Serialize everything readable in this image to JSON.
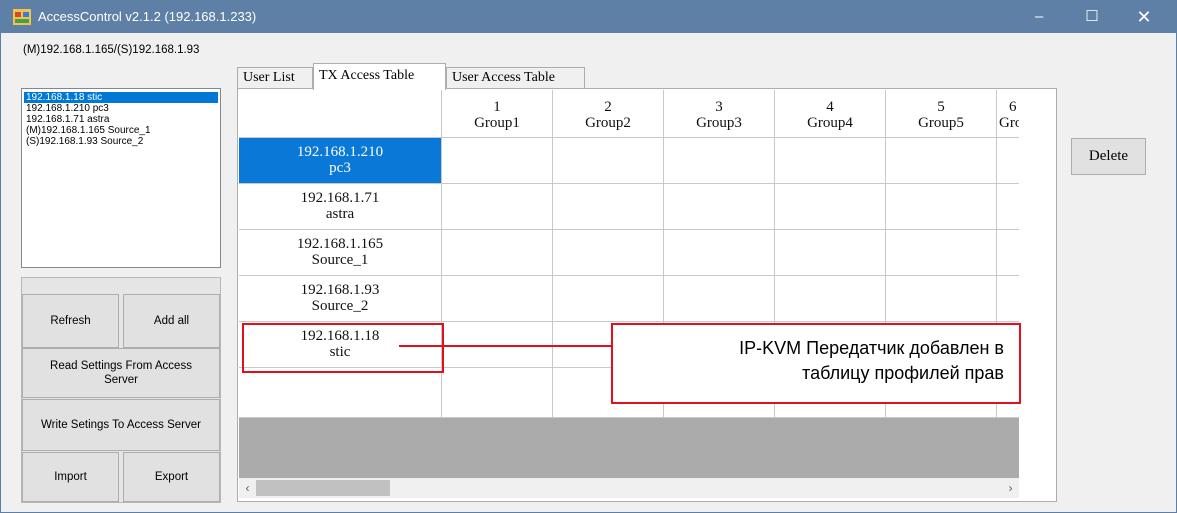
{
  "window": {
    "title": "AccessControl v2.1.2 (192.168.1.233)",
    "icon": "app-window-icon",
    "controls": {
      "minimize": "–",
      "maximize": "☐",
      "close": "✕"
    }
  },
  "connection_label": "(M)192.168.1.165/(S)192.168.1.93",
  "device_list": [
    {
      "label": "192.168.1.18 stic",
      "selected": true
    },
    {
      "label": "192.168.1.210 pc3",
      "selected": false
    },
    {
      "label": "192.168.1.71 astra",
      "selected": false
    },
    {
      "label": "(M)192.168.1.165 Source_1",
      "selected": false
    },
    {
      "label": "(S)192.168.1.93 Source_2",
      "selected": false
    }
  ],
  "buttons": {
    "refresh": "Refresh",
    "add_all": "Add all",
    "read_settings": "Read Settings From Access Server",
    "write_settings": "Write Setings To Access Server",
    "import": "Import",
    "export": "Export",
    "delete": "Delete"
  },
  "tabs": [
    {
      "label": "User List",
      "active": false
    },
    {
      "label": "TX Access Table",
      "active": true
    },
    {
      "label": "User Access Table",
      "active": false
    }
  ],
  "table": {
    "columns": [
      {
        "num": "1",
        "name": "Group1"
      },
      {
        "num": "2",
        "name": "Group2"
      },
      {
        "num": "3",
        "name": "Group3"
      },
      {
        "num": "4",
        "name": "Group4"
      },
      {
        "num": "5",
        "name": "Group5"
      },
      {
        "num": "6",
        "name": "Gro"
      }
    ],
    "rows": [
      {
        "ip": "192.168.1.210",
        "name": "pc3",
        "selected": true
      },
      {
        "ip": "192.168.1.71",
        "name": "astra",
        "selected": false
      },
      {
        "ip": "192.168.1.165",
        "name": "Source_1",
        "selected": false
      },
      {
        "ip": "192.168.1.93",
        "name": "Source_2",
        "selected": false
      },
      {
        "ip": "192.168.1.18",
        "name": "stic",
        "selected": false
      }
    ]
  },
  "scrollbar": {
    "left_arrow": "‹",
    "right_arrow": "›"
  },
  "callout": {
    "line1": "IP-KVM Передатчик добавлен в",
    "line2": "таблицу профилей прав"
  },
  "colors": {
    "titlebar": "#5e80a6",
    "selection": "#0078d7",
    "annotation": "#e0101c"
  }
}
